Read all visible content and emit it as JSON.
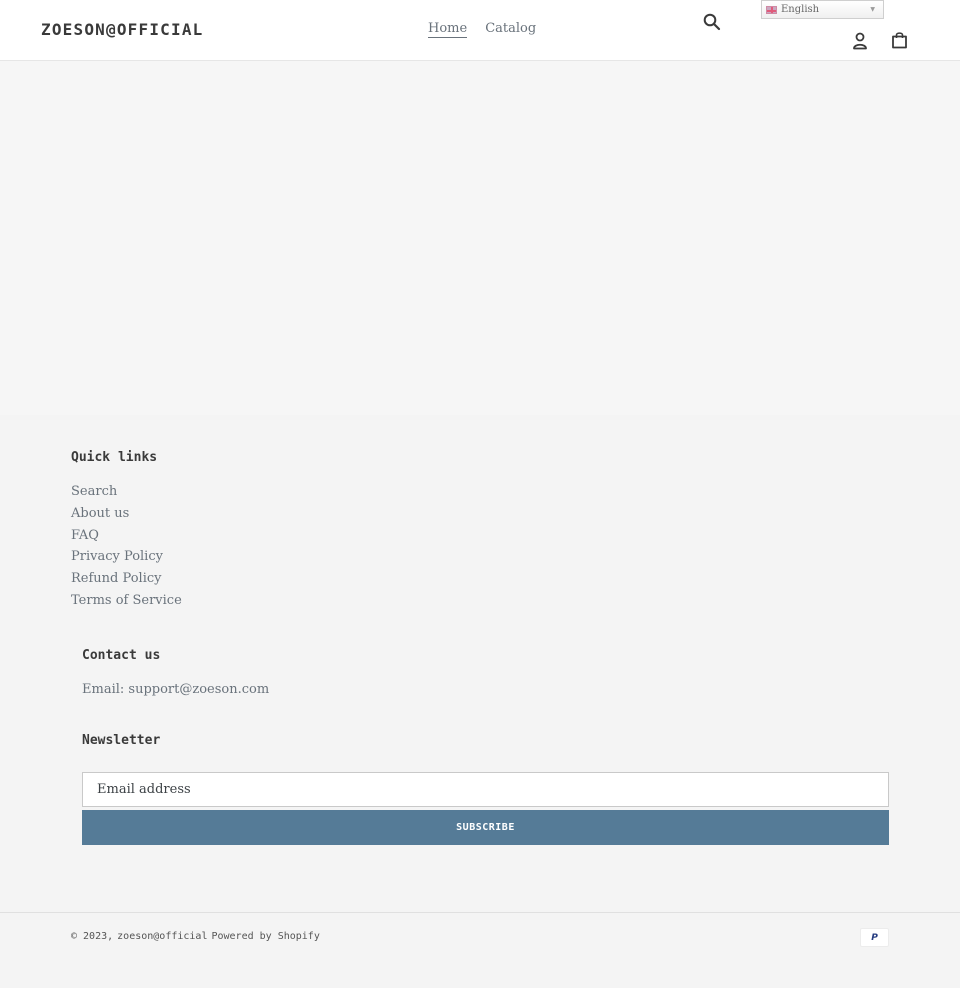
{
  "header": {
    "logo": "ZOESON@OFFICIAL",
    "nav": [
      {
        "label": "Home",
        "active": true
      },
      {
        "label": "Catalog",
        "active": false
      }
    ],
    "language": {
      "selected": "English",
      "flag": "uk-flag-icon"
    },
    "icons": {
      "search": "search-icon",
      "account": "user-icon",
      "cart": "shopping-bag-icon"
    }
  },
  "footer": {
    "quick_links": {
      "heading": "Quick links",
      "items": [
        "Search",
        "About us",
        "FAQ",
        "Privacy Policy",
        "Refund Policy",
        "Terms of Service"
      ]
    },
    "contact": {
      "heading": "Contact us",
      "email_text": "Email: support@zoeson.com"
    },
    "newsletter": {
      "heading": "Newsletter",
      "email_placeholder": "Email address",
      "email_value": "",
      "subscribe_label": "SUBSCRIBE",
      "button_color": "#557b97"
    },
    "copyright": {
      "prefix": "© 2023,",
      "store_link": "zoeson@official",
      "powered_by": "Powered by Shopify"
    },
    "payment_icons": [
      {
        "name": "paypal-icon",
        "glyph": "P"
      }
    ]
  }
}
